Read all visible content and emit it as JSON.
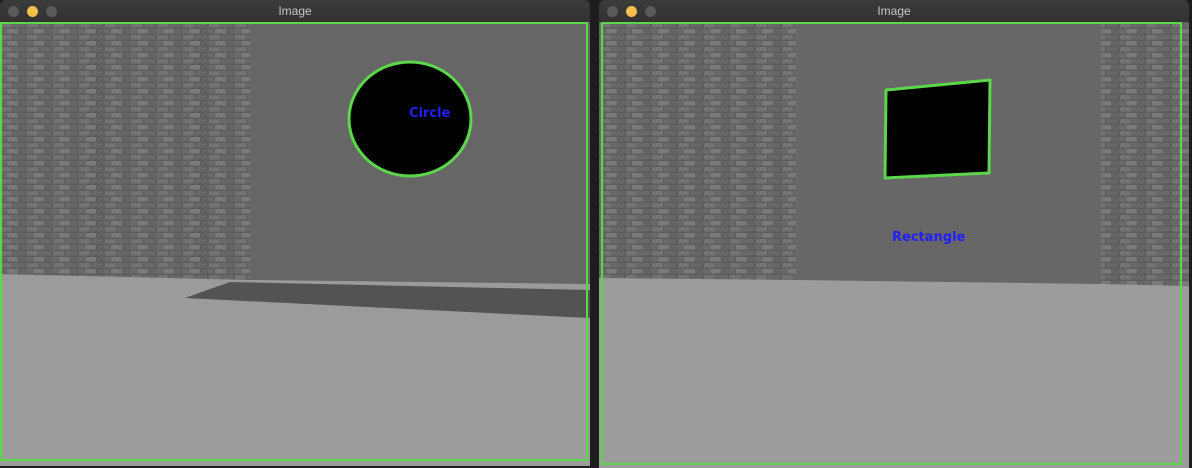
{
  "windows": [
    {
      "title": "Image",
      "detected_shape_label": "Circle"
    },
    {
      "title": "Image",
      "detected_shape_label": "Rectangle"
    }
  ],
  "colors": {
    "contour": "#5cd64a",
    "label": "#1f1fff",
    "wall": "#666666",
    "floor": "#9b9b9b",
    "brick": "#6b6b6b",
    "hole": "#000000"
  },
  "icons": {
    "close": "window-close-icon",
    "minimize": "window-minimize-icon",
    "zoom": "window-zoom-icon"
  }
}
